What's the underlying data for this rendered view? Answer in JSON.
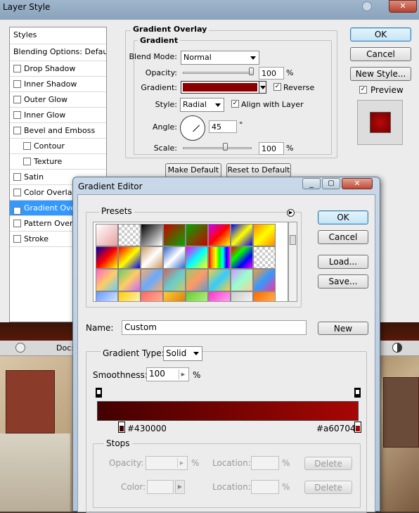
{
  "layer_style": {
    "title": "Layer Style",
    "styles_header": "Styles",
    "blending_options": "Blending Options: Default",
    "items": [
      {
        "label": "Drop Shadow",
        "checked": false,
        "indent": false
      },
      {
        "label": "Inner Shadow",
        "checked": false,
        "indent": false
      },
      {
        "label": "Outer Glow",
        "checked": false,
        "indent": false
      },
      {
        "label": "Inner Glow",
        "checked": false,
        "indent": false
      },
      {
        "label": "Bevel and Emboss",
        "checked": false,
        "indent": false
      },
      {
        "label": "Contour",
        "checked": false,
        "indent": true
      },
      {
        "label": "Texture",
        "checked": false,
        "indent": true
      },
      {
        "label": "Satin",
        "checked": false,
        "indent": false
      },
      {
        "label": "Color Overlay",
        "checked": false,
        "indent": false
      },
      {
        "label": "Gradient Overlay",
        "checked": true,
        "indent": false,
        "selected": true
      },
      {
        "label": "Pattern Overlay",
        "checked": false,
        "indent": false
      },
      {
        "label": "Stroke",
        "checked": false,
        "indent": false
      }
    ],
    "section_title": "Gradient Overlay",
    "group_title": "Gradient",
    "blend_mode_label": "Blend Mode:",
    "blend_mode_value": "Normal",
    "opacity_label": "Opacity:",
    "opacity_value": "100",
    "opacity_unit": "%",
    "gradient_label": "Gradient:",
    "reverse_label": "Reverse",
    "reverse_checked": true,
    "style_label": "Style:",
    "style_value": "Radial",
    "align_label": "Align with Layer",
    "align_checked": true,
    "angle_label": "Angle:",
    "angle_value": "45",
    "angle_unit": "°",
    "scale_label": "Scale:",
    "scale_value": "100",
    "scale_unit": "%",
    "make_default": "Make Default",
    "reset_default": "Reset to Default",
    "ok": "OK",
    "cancel": "Cancel",
    "new_style": "New Style...",
    "preview_label": "Preview",
    "preview_checked": true
  },
  "gradient_editor": {
    "title": "Gradient Editor",
    "presets_label": "Presets",
    "ok": "OK",
    "cancel": "Cancel",
    "load": "Load...",
    "save": "Save...",
    "name_label": "Name:",
    "name_value": "Custom",
    "new_button": "New",
    "gradient_type_label": "Gradient Type:",
    "gradient_type_value": "Solid",
    "smoothness_label": "Smoothness:",
    "smoothness_value": "100",
    "smoothness_unit": "%",
    "left_stop_color": "#430000",
    "right_stop_color": "#a60704",
    "stops_label": "Stops",
    "stop_opacity_label": "Opacity:",
    "stop_opacity_unit": "%",
    "stop_location_label": "Location:",
    "stop_location_unit": "%",
    "stop_color_label": "Color:",
    "delete_label": "Delete"
  },
  "photoshop_bar": {
    "doc_label": "Doc:"
  },
  "colors": {
    "gradient_start": "#430000",
    "gradient_end": "#a60704",
    "selection": "#3399ff"
  }
}
